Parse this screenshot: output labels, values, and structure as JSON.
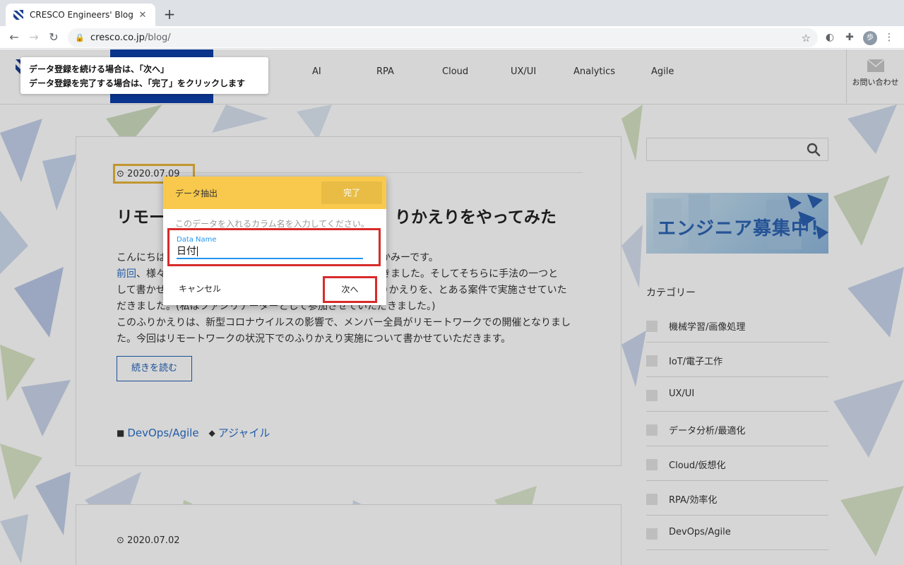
{
  "browser": {
    "tab_title": "CRESCO Engineers' Blog",
    "tab_close": "✕",
    "new_tab": "+",
    "url_host": "cresco.co.jp",
    "url_path": "/blog/",
    "avatar_initial": "歩"
  },
  "site": {
    "nav": [
      "AI",
      "RPA",
      "Cloud",
      "UX/UI",
      "Analytics",
      "Agile"
    ],
    "contact_label": "お問い合わせ",
    "brand_color": "#0e3ea8"
  },
  "tooltip": {
    "line1": "データ登録を続ける場合は、「次へ」",
    "line2": "データ登録を完了する場合は、「完了」をクリックします"
  },
  "article": {
    "date": "2020.07.09",
    "title_left": "リモー",
    "title_right": "りかえりをやってみた",
    "lines": [
      {
        "a": "こんにちは",
        "b": "かみーです。"
      },
      {
        "link": "前回",
        "a": "、様々",
        "b": "だきました。そしてそちらに手法の一つと"
      },
      {
        "a": "して書かせ",
        "b": "りかえりを、とある案件で実施させていた"
      },
      {
        "a": "だきました。",
        "b": "(私はファシリテーターとして参加させていただきました。)"
      },
      {
        "a": "このふりかえりは、新型コロナウイルスの影響で、メンバー全員がリモートワークでの開催となりまし"
      },
      {
        "a": "た。今回はリモートワークの状況下でのふりかえり実施について書かせていただきます。"
      }
    ],
    "read_more": "続きを読む",
    "tag_category": "DevOps/Agile",
    "tag_keyword": "アジャイル"
  },
  "article2": {
    "date": "2020.07.02"
  },
  "sidebar": {
    "banner_text": "エンジニア募集中！",
    "categories_heading": "カテゴリー",
    "categories": [
      "機械学習/画像処理",
      "IoT/電子工作",
      "UX/UI",
      "データ分析/最適化",
      "Cloud/仮想化",
      "RPA/効率化",
      "DevOps/Agile"
    ]
  },
  "dialog": {
    "title": "データ抽出",
    "done_label": "完了",
    "hint": "このデータを入れるカラム名を入力してください。",
    "field_label": "Data Name",
    "field_value": "日付",
    "cancel_label": "キャンセル",
    "next_label": "次へ",
    "header_color": "#f8c94c",
    "highlight_color": "#d82b2b"
  }
}
